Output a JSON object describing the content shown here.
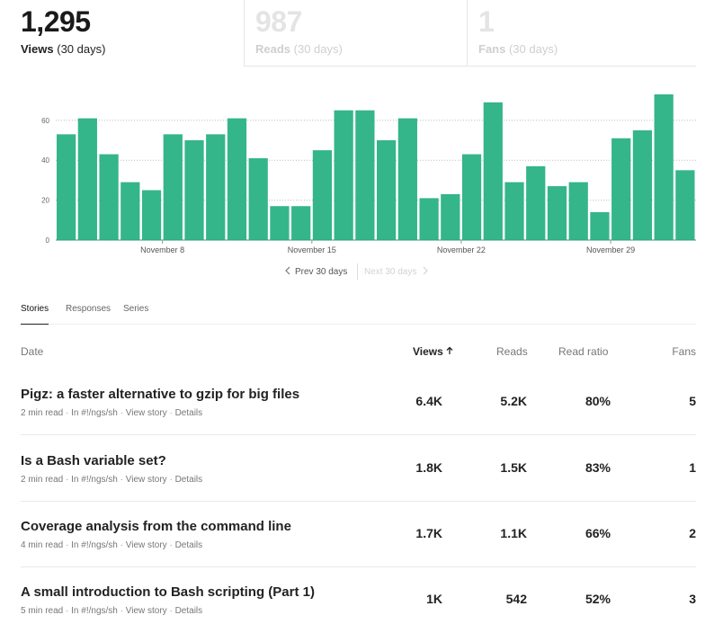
{
  "stats": {
    "views": {
      "value": "1,295",
      "label": "Views",
      "period": "(30 days)"
    },
    "reads": {
      "value": "987",
      "label": "Reads",
      "period": "(30 days)"
    },
    "fans": {
      "value": "1",
      "label": "Fans",
      "period": "(30 days)"
    }
  },
  "chart_data": {
    "type": "bar",
    "title": "",
    "xlabel": "",
    "ylabel": "",
    "ylim": [
      0,
      75
    ],
    "yticks": [
      0,
      20,
      40,
      60
    ],
    "x_tick_labels": [
      {
        "label": "November 8",
        "index": 4.5
      },
      {
        "label": "November 15",
        "index": 11.5
      },
      {
        "label": "November 22",
        "index": 18.5
      },
      {
        "label": "November 29",
        "index": 25.5
      }
    ],
    "values": [
      53,
      61,
      43,
      29,
      25,
      53,
      50,
      53,
      61,
      41,
      17,
      17,
      45,
      65,
      65,
      50,
      61,
      21,
      23,
      43,
      69,
      29,
      37,
      27,
      29,
      14,
      51,
      55,
      73,
      35
    ],
    "bar_color": "#35b58a",
    "grid": "dotted horizontal"
  },
  "pager": {
    "prev": "Prev 30 days",
    "next": "Next 30 days"
  },
  "tabs": [
    "Stories",
    "Responses",
    "Series"
  ],
  "table": {
    "headers": {
      "date": "Date",
      "views": "Views",
      "reads": "Reads",
      "ratio": "Read ratio",
      "fans": "Fans"
    },
    "rows": [
      {
        "title": "Pigz: a faster alternative to gzip for big files",
        "read_time": "2 min read",
        "in": "In #!/ngs/sh",
        "view": "View story",
        "details": "Details",
        "views": "6.4K",
        "reads": "5.2K",
        "ratio": "80%",
        "fans": "5"
      },
      {
        "title": "Is a Bash variable set?",
        "read_time": "2 min read",
        "in": "In #!/ngs/sh",
        "view": "View story",
        "details": "Details",
        "views": "1.8K",
        "reads": "1.5K",
        "ratio": "83%",
        "fans": "1"
      },
      {
        "title": "Coverage analysis from the command line",
        "read_time": "4 min read",
        "in": "In #!/ngs/sh",
        "view": "View story",
        "details": "Details",
        "views": "1.7K",
        "reads": "1.1K",
        "ratio": "66%",
        "fans": "2"
      },
      {
        "title": "A small introduction to Bash scripting (Part 1)",
        "read_time": "5 min read",
        "in": "In #!/ngs/sh",
        "view": "View story",
        "details": "Details",
        "views": "1K",
        "reads": "542",
        "ratio": "52%",
        "fans": "3"
      }
    ]
  },
  "icons": {
    "sort": "arrow-up-icon",
    "prev": "chevron-left-icon",
    "next": "chevron-right-icon"
  }
}
